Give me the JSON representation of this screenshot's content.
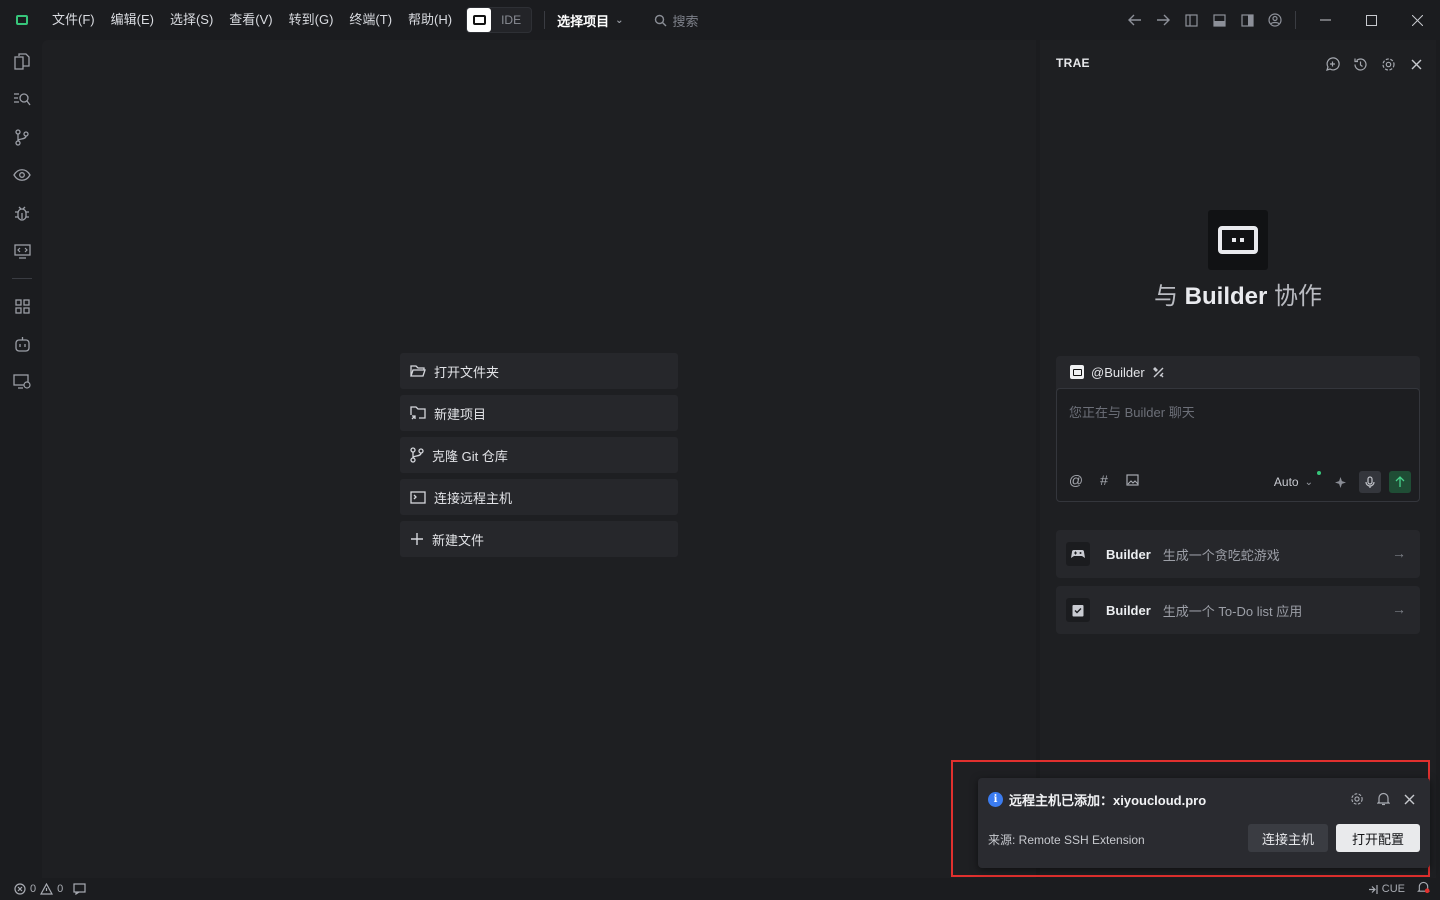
{
  "titlebar": {
    "menus": [
      "文件(F)",
      "编辑(E)",
      "选择(S)",
      "查看(V)",
      "转到(G)",
      "终端(T)",
      "帮助(H)"
    ],
    "mode_label": "IDE",
    "project_select": "选择项目",
    "search_placeholder": "搜索"
  },
  "welcome": {
    "items": [
      "打开文件夹",
      "新建项目",
      "克隆 Git 仓库",
      "连接远程主机",
      "新建文件"
    ]
  },
  "panel": {
    "title": "TRAE",
    "hero_prefix": "与",
    "hero_agent": "Builder",
    "hero_suffix": "协作",
    "agent_tag": "@Builder",
    "input_placeholder": "您正在与 Builder 聊天",
    "model": "Auto",
    "suggestions": [
      {
        "agent": "Builder",
        "text": "生成一个贪吃蛇游戏"
      },
      {
        "agent": "Builder",
        "text": "生成一个 To-Do list 应用"
      }
    ]
  },
  "notification": {
    "title": "远程主机已添加：xiyoucloud.pro",
    "source": "来源: Remote SSH Extension",
    "secondary_button": "连接主机",
    "primary_button": "打开配置"
  },
  "status": {
    "errors": "0",
    "warnings": "0",
    "cue": "CUE"
  },
  "colors": {
    "accent_green": "#37c57a",
    "info_blue": "#3b7cf0",
    "highlight_red": "#e0302e"
  }
}
